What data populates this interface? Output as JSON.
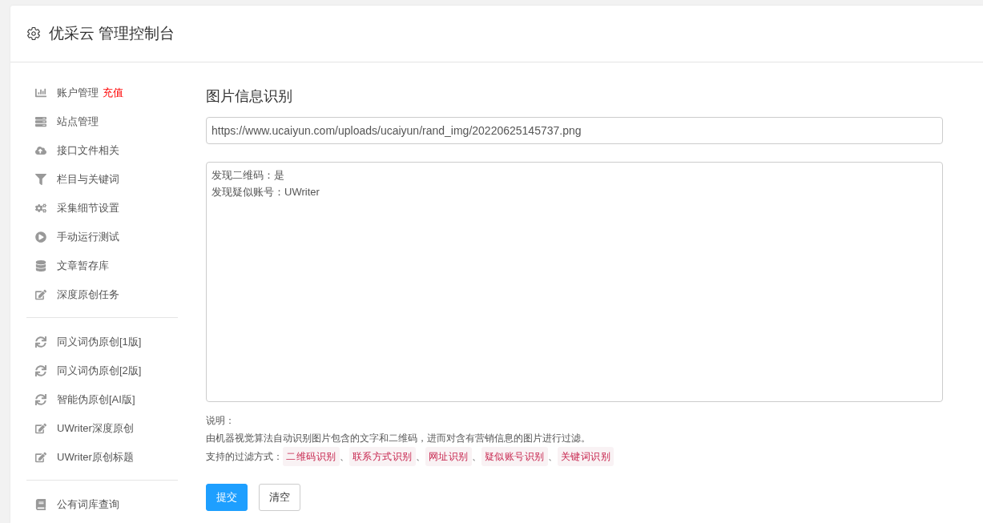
{
  "header": {
    "title": "优采云 管理控制台"
  },
  "sidebar": {
    "groups": [
      [
        {
          "label": "账户管理",
          "badge": "充值"
        },
        {
          "label": "站点管理"
        },
        {
          "label": "接口文件相关"
        },
        {
          "label": "栏目与关键词"
        },
        {
          "label": "采集细节设置"
        },
        {
          "label": "手动运行测试"
        },
        {
          "label": "文章暂存库"
        },
        {
          "label": "深度原创任务"
        }
      ],
      [
        {
          "label": "同义词伪原创[1版]"
        },
        {
          "label": "同义词伪原创[2版]"
        },
        {
          "label": "智能伪原创[AI版]"
        },
        {
          "label": "UWriter深度原创"
        },
        {
          "label": "UWriter原创标题"
        }
      ],
      [
        {
          "label": "公有词库查询"
        }
      ]
    ]
  },
  "main": {
    "title": "图片信息识别",
    "url_field": {
      "value": "https://www.ucaiyun.com/uploads/ucaiyun/rand_img/20220625145737.png"
    },
    "result_field": {
      "lines": [
        "发现二维码：是",
        "发现疑似账号：UWriter"
      ]
    },
    "notes": {
      "heading": "说明：",
      "description": "由机器视觉算法自动识别图片包含的文字和二维码，进而对含有营销信息的图片进行过滤。",
      "methods_label": "支持的过滤方式：",
      "separator": "、",
      "methods": [
        "二维码识别",
        "联系方式识别",
        "网址识别",
        "疑似账号识别",
        "关键词识别"
      ]
    },
    "buttons": [
      {
        "label": "提交",
        "kind": "primary"
      },
      {
        "label": "清空",
        "kind": "default"
      }
    ]
  }
}
